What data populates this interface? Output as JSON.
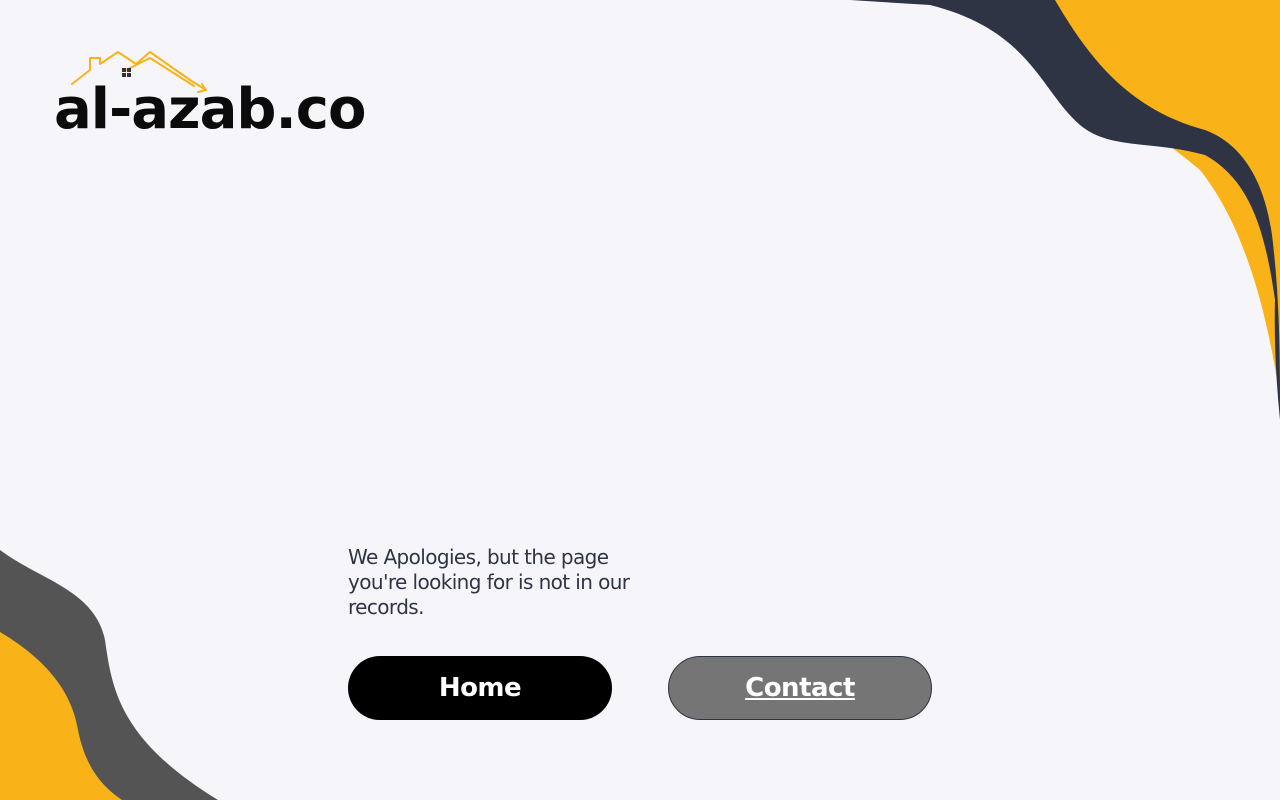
{
  "logo": {
    "text": "al-azab.co"
  },
  "message": {
    "text": "We Apologies, but the page you're looking for is not in our records."
  },
  "buttons": {
    "home_label": "Home",
    "contact_label": "Contact"
  },
  "colors": {
    "background": "#f6f6fa",
    "accent_yellow": "#f9b218",
    "wave_navy": "#2f3444",
    "wave_gray": "#545454",
    "home_button": "#000000",
    "contact_button": "#757575",
    "text": "#2f3444"
  },
  "icons": {
    "logo_mark": "house-roof-icon"
  }
}
